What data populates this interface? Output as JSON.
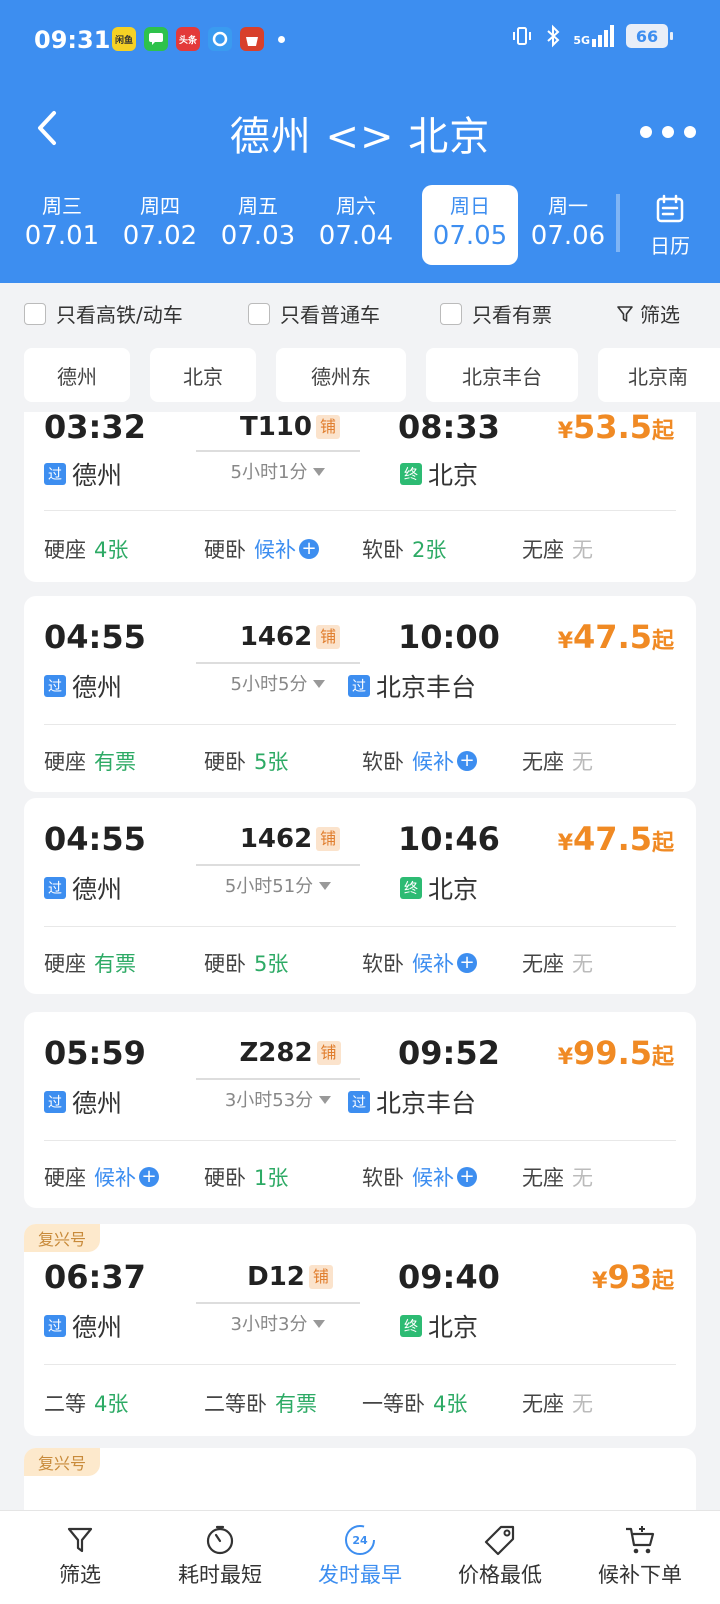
{
  "status_bar": {
    "time": "09:31",
    "apps": [
      {
        "name": "闲鱼",
        "color": "#f5d125"
      },
      {
        "name": "",
        "color": "#2ec24b"
      },
      {
        "name": "头条",
        "color": "#e33a3a"
      },
      {
        "name": "",
        "color": "#3a9bf0"
      },
      {
        "name": "",
        "color": "#d8402b"
      }
    ],
    "network": "5G",
    "battery": "66"
  },
  "header": {
    "title": "德州 <> 北京",
    "calendar_label": "日历"
  },
  "dates": [
    {
      "weekday": "周三",
      "date": "07.01"
    },
    {
      "weekday": "周四",
      "date": "07.02"
    },
    {
      "weekday": "周五",
      "date": "07.03"
    },
    {
      "weekday": "周六",
      "date": "07.04"
    },
    {
      "weekday": "周日",
      "date": "07.05"
    },
    {
      "weekday": "周一",
      "date": "07.06"
    }
  ],
  "filters": {
    "only_gaotie": "只看高铁/动车",
    "only_putong": "只看普通车",
    "only_youpiao": "只看有票",
    "filter_btn": "筛选"
  },
  "stations": [
    "德州",
    "北京",
    "德州东",
    "北京丰台",
    "北京南"
  ],
  "trains": [
    {
      "dep_time": "03:32",
      "dep_station": "德州",
      "dep_tag": "过",
      "train_no": "T110",
      "bunk": "铺",
      "duration": "5小时1分",
      "arr_time": "08:33",
      "arr_station": "北京",
      "arr_tag": "终",
      "price_symbol": "¥",
      "price": "53.5",
      "price_suffix": "起",
      "seats": [
        {
          "type": "硬座",
          "value": "4张",
          "style": "green"
        },
        {
          "type": "硬卧",
          "value": "候补",
          "style": "blue"
        },
        {
          "type": "软卧",
          "value": "2张",
          "style": "green"
        },
        {
          "type": "无座",
          "value": "无",
          "style": "gray"
        }
      ]
    },
    {
      "dep_time": "04:55",
      "dep_station": "德州",
      "dep_tag": "过",
      "train_no": "1462",
      "bunk": "铺",
      "duration": "5小时5分",
      "arr_time": "10:00",
      "arr_station": "北京丰台",
      "arr_tag": "过",
      "price_symbol": "¥",
      "price": "47.5",
      "price_suffix": "起",
      "seats": [
        {
          "type": "硬座",
          "value": "有票",
          "style": "green"
        },
        {
          "type": "硬卧",
          "value": "5张",
          "style": "green"
        },
        {
          "type": "软卧",
          "value": "候补",
          "style": "blue"
        },
        {
          "type": "无座",
          "value": "无",
          "style": "gray"
        }
      ]
    },
    {
      "dep_time": "04:55",
      "dep_station": "德州",
      "dep_tag": "过",
      "train_no": "1462",
      "bunk": "铺",
      "duration": "5小时51分",
      "arr_time": "10:46",
      "arr_station": "北京",
      "arr_tag": "终",
      "price_symbol": "¥",
      "price": "47.5",
      "price_suffix": "起",
      "seats": [
        {
          "type": "硬座",
          "value": "有票",
          "style": "green"
        },
        {
          "type": "硬卧",
          "value": "5张",
          "style": "green"
        },
        {
          "type": "软卧",
          "value": "候补",
          "style": "blue"
        },
        {
          "type": "无座",
          "value": "无",
          "style": "gray"
        }
      ]
    },
    {
      "dep_time": "05:59",
      "dep_station": "德州",
      "dep_tag": "过",
      "train_no": "Z282",
      "bunk": "铺",
      "duration": "3小时53分",
      "arr_time": "09:52",
      "arr_station": "北京丰台",
      "arr_tag": "过",
      "price_symbol": "¥",
      "price": "99.5",
      "price_suffix": "起",
      "seats": [
        {
          "type": "硬座",
          "value": "候补",
          "style": "blue"
        },
        {
          "type": "硬卧",
          "value": "1张",
          "style": "green"
        },
        {
          "type": "软卧",
          "value": "候补",
          "style": "blue"
        },
        {
          "type": "无座",
          "value": "无",
          "style": "gray"
        }
      ]
    },
    {
      "badge": "复兴号",
      "dep_time": "06:37",
      "dep_station": "德州",
      "dep_tag": "过",
      "train_no": "D12",
      "bunk": "铺",
      "duration": "3小时3分",
      "arr_time": "09:40",
      "arr_station": "北京",
      "arr_tag": "终",
      "price_symbol": "¥",
      "price": "93",
      "price_suffix": "起",
      "seats": [
        {
          "type": "二等",
          "value": "4张",
          "style": "green"
        },
        {
          "type": "二等卧",
          "value": "有票",
          "style": "green"
        },
        {
          "type": "一等卧",
          "value": "4张",
          "style": "green"
        },
        {
          "type": "无座",
          "value": "无",
          "style": "gray"
        }
      ]
    }
  ],
  "partial_card_badge": "复兴号",
  "bottom_nav": [
    {
      "label": "筛选",
      "icon": "filter-icon"
    },
    {
      "label": "耗时最短",
      "icon": "timer-icon"
    },
    {
      "label": "发时最早",
      "icon": "clock-24-icon",
      "icon_text": "24"
    },
    {
      "label": "价格最低",
      "icon": "price-tag-icon"
    },
    {
      "label": "候补下单",
      "icon": "cart-plus-icon"
    }
  ]
}
